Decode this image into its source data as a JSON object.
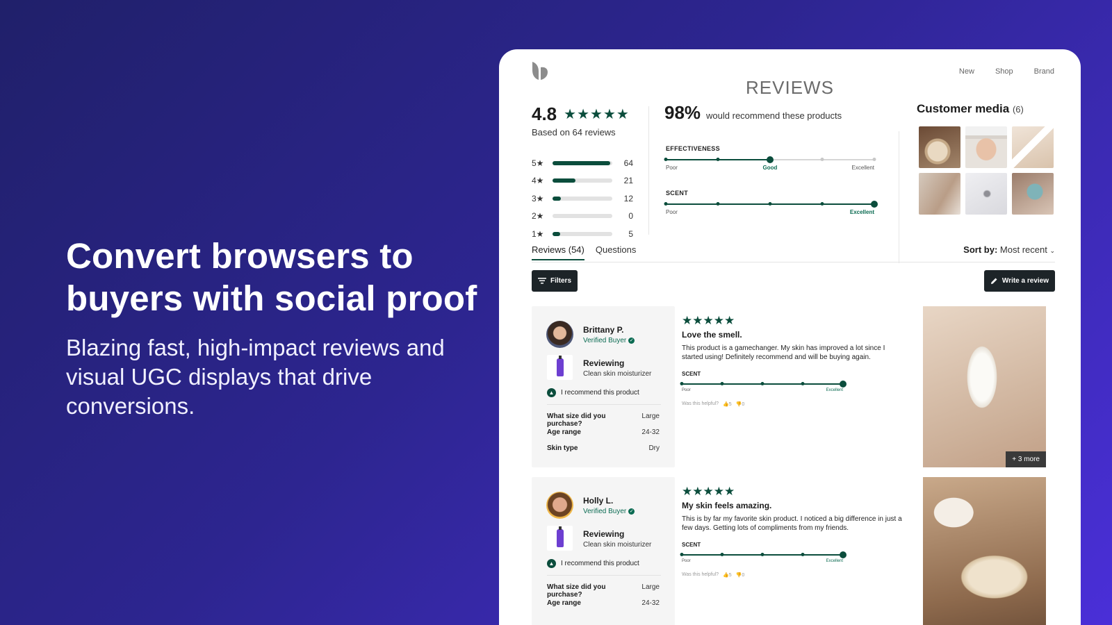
{
  "hero": {
    "headline": "Convert browsers to buyers with social proof",
    "subtitle": "Blazing fast, high-impact reviews and visual UGC displays that drive conversions."
  },
  "nav": {
    "items": [
      "New",
      "Shop",
      "Brand"
    ]
  },
  "page": {
    "title": "REVIEWS"
  },
  "summary": {
    "rating": "4.8",
    "stars": "★★★★★",
    "based_on": "Based on 64 reviews",
    "distribution": [
      {
        "label": "5★",
        "count": "64",
        "fraction": 0.96
      },
      {
        "label": "4★",
        "count": "21",
        "fraction": 0.38
      },
      {
        "label": "3★",
        "count": "12",
        "fraction": 0.14
      },
      {
        "label": "2★",
        "count": "0",
        "fraction": 0
      },
      {
        "label": "1★",
        "count": "5",
        "fraction": 0.13
      }
    ],
    "recommend_pct": "98%",
    "recommend_text": "would recommend these products",
    "attributes": [
      {
        "name": "EFFECTIVENESS",
        "low": "Poor",
        "selected_label": "Good",
        "high": "Excellent",
        "selected_index": 2
      },
      {
        "name": "SCENT",
        "low": "Poor",
        "selected_label": "Excellent",
        "high": "",
        "selected_index": 4
      }
    ]
  },
  "media": {
    "title": "Customer media",
    "count": "(6)"
  },
  "tabs": {
    "reviews": "Reviews (54)",
    "questions": "Questions"
  },
  "sort": {
    "label": "Sort by:",
    "value": "Most recent"
  },
  "buttons": {
    "filters": "Filters",
    "write": "Write a review"
  },
  "reviews": [
    {
      "name": "Brittany P.",
      "verified": "Verified Buyer",
      "reviewing_label": "Reviewing",
      "product": "Clean skin moisturizer",
      "recommend": "I recommend this product",
      "qa": [
        {
          "q": "What size did you purchase?",
          "a": "Large"
        },
        {
          "q": "Age range",
          "a": "24-32"
        },
        {
          "q": "Skin type",
          "a": "Dry"
        }
      ],
      "stars": "★★★★★",
      "title": "Love the smell.",
      "text": "This product is a gamechanger. My skin has improved a lot since I started using! Definitely recommend and will be buying again.",
      "attr_name": "SCENT",
      "attr_low": "Poor",
      "attr_high": "Excellent",
      "helpful": "Was this helpful?",
      "up": "5",
      "down": "0",
      "more": "+ 3 more"
    },
    {
      "name": "Holly L.",
      "verified": "Verified Buyer",
      "reviewing_label": "Reviewing",
      "product": "Clean skin moisturizer",
      "recommend": "I recommend this product",
      "qa": [
        {
          "q": "What size did you purchase?",
          "a": "Large"
        },
        {
          "q": "Age range",
          "a": "24-32"
        }
      ],
      "stars": "★★★★★",
      "title": "My skin feels amazing.",
      "text": "This is by far my favorite skin product. I noticed a big difference in just a few days. Getting lots of compliments from my friends.",
      "attr_name": "SCENT",
      "attr_low": "Poor",
      "attr_high": "Excellent",
      "helpful": "Was this helpful?",
      "up": "5",
      "down": "0"
    }
  ],
  "colors": {
    "accent": "#0b4d3c",
    "background_start": "#20206a",
    "background_end": "#4a2fd8",
    "button_dark": "#1d2428"
  }
}
